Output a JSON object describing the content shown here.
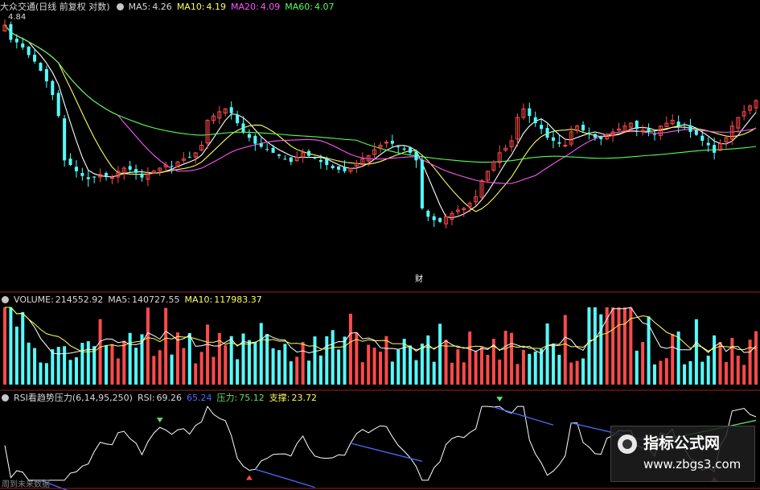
{
  "header_price": {
    "name": "大众交通(日线 前复权 对数)",
    "ma5_label": "MA5:",
    "ma5_value": "4.26",
    "ma10_label": "MA10:",
    "ma10_value": "4.19",
    "ma20_label": "MA20:",
    "ma20_value": "4.09",
    "ma60_label": "MA60:",
    "ma60_value": "4.07"
  },
  "header_volume": {
    "vol_label": "VOLUME:",
    "vol_value": "214552.92",
    "ma5_label": "MA5:",
    "ma5_value": "140727.55",
    "ma10_label": "MA10:",
    "ma10_value": "117983.37"
  },
  "header_rsi": {
    "name": "RSI看趋势压力(6,14,95,250)",
    "rsi_label": "RSI:",
    "rsi_value": "69.26",
    "blue_value": "65.24",
    "press_label": "压力:",
    "press_value": "75.12",
    "support_label": "支撑:",
    "support_value": "23.72"
  },
  "annotations": {
    "high_price": "4.84",
    "cai_label": "财",
    "footer_text": "周到未来数据"
  },
  "watermark": {
    "title": "指标公式网",
    "url": "www.zbgs3.com"
  },
  "colors": {
    "up": "#ff4a4a",
    "down": "#54ffff",
    "ma5": "#ffffff",
    "ma10": "#ffff55",
    "ma20": "#ff55ff",
    "ma60": "#55ff55",
    "rsi": "#ffffff",
    "rsi_blue": "#4a6bff",
    "resistance": "#4a6bff",
    "support": "#66dd66",
    "divider": "#a02020"
  },
  "chart_data": {
    "type": "candlestick",
    "ma_periods": [
      5,
      10,
      20,
      60
    ],
    "candles_close_series": [
      4.84,
      4.72,
      4.7,
      4.66,
      4.6,
      4.55,
      4.48,
      4.4,
      4.3,
      4.15,
      3.85,
      3.82,
      3.78,
      3.75,
      3.73,
      3.74,
      3.76,
      3.75,
      3.74,
      3.78,
      3.8,
      3.79,
      3.77,
      3.74,
      3.76,
      3.78,
      3.8,
      3.82,
      3.81,
      3.84,
      3.86,
      3.87,
      3.9,
      3.95,
      4.12,
      4.15,
      4.18,
      4.2,
      4.17,
      4.1,
      4.04,
      4.0,
      3.96,
      3.94,
      3.92,
      3.9,
      3.88,
      3.86,
      3.84,
      3.87,
      3.9,
      3.88,
      3.86,
      3.84,
      3.82,
      3.8,
      3.79,
      3.78,
      3.8,
      3.83,
      3.86,
      3.88,
      3.92,
      3.95,
      3.97,
      3.96,
      3.94,
      3.92,
      3.9,
      3.85,
      3.55,
      3.5,
      3.48,
      3.47,
      3.5,
      3.52,
      3.54,
      3.55,
      3.58,
      3.62,
      3.72,
      3.78,
      3.84,
      3.9,
      3.93,
      3.98,
      4.14,
      4.2,
      4.15,
      4.1,
      4.06,
      4.0,
      3.98,
      3.96,
      3.95,
      4.04,
      4.08,
      4.05,
      4.03,
      4.0,
      3.99,
      4.02,
      4.04,
      4.06,
      4.08,
      4.1,
      4.06,
      4.05,
      4.04,
      4.02,
      4.08,
      4.1,
      4.12,
      4.08,
      4.07,
      4.04,
      4.02,
      3.98,
      3.95,
      3.9,
      3.96,
      4.0,
      4.08,
      4.14,
      4.18,
      4.22,
      4.26
    ]
  }
}
